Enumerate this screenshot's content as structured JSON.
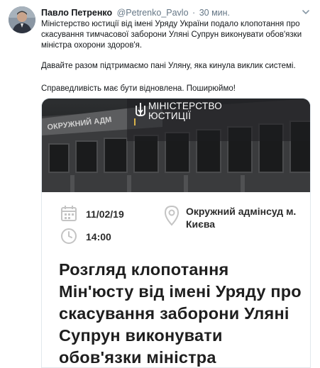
{
  "tweet": {
    "author_name": "Павло Петренко",
    "handle": "@Petrenko_Pavlo",
    "separator": "·",
    "time": "30 мин.",
    "paragraph1": "Міністерство юстиції від імені Уряду України подало клопотання про скасування тимчасової заборони Уляні Супрун виконувати обов'язки міністра охорони здоров'я.",
    "paragraph2": "Давайте разом підтримаємо пані Уляну, яка кинула виклик системі.",
    "paragraph3": "Справедливість має бути відновлена. Поширюймо!"
  },
  "card": {
    "ministry_line1": "МІНІСТЕРСТВО",
    "ministry_line2": "ЮСТИЦІЇ",
    "sign_text": "ОКРУЖНИЙ АДМ",
    "date": "11/02/19",
    "time": "14:00",
    "place": "Окружний адмінсуд м. Києва",
    "headline": "Розгляд клопотання Мін'юсту від імені Уряду про скасування заборони Уляні Супрун виконувати обов'язки міністра"
  },
  "icons": {
    "calendar": "calendar-icon",
    "clock": "clock-icon",
    "location": "location-pin-icon",
    "chevron": "chevron-down-icon",
    "emblem": "trident-emblem-icon"
  },
  "colors": {
    "text": "#14171a",
    "muted": "#657786",
    "icon_gray": "#c4c4c4",
    "emblem_gold": "#d8b24a",
    "photo_dark": "#1f2123"
  }
}
